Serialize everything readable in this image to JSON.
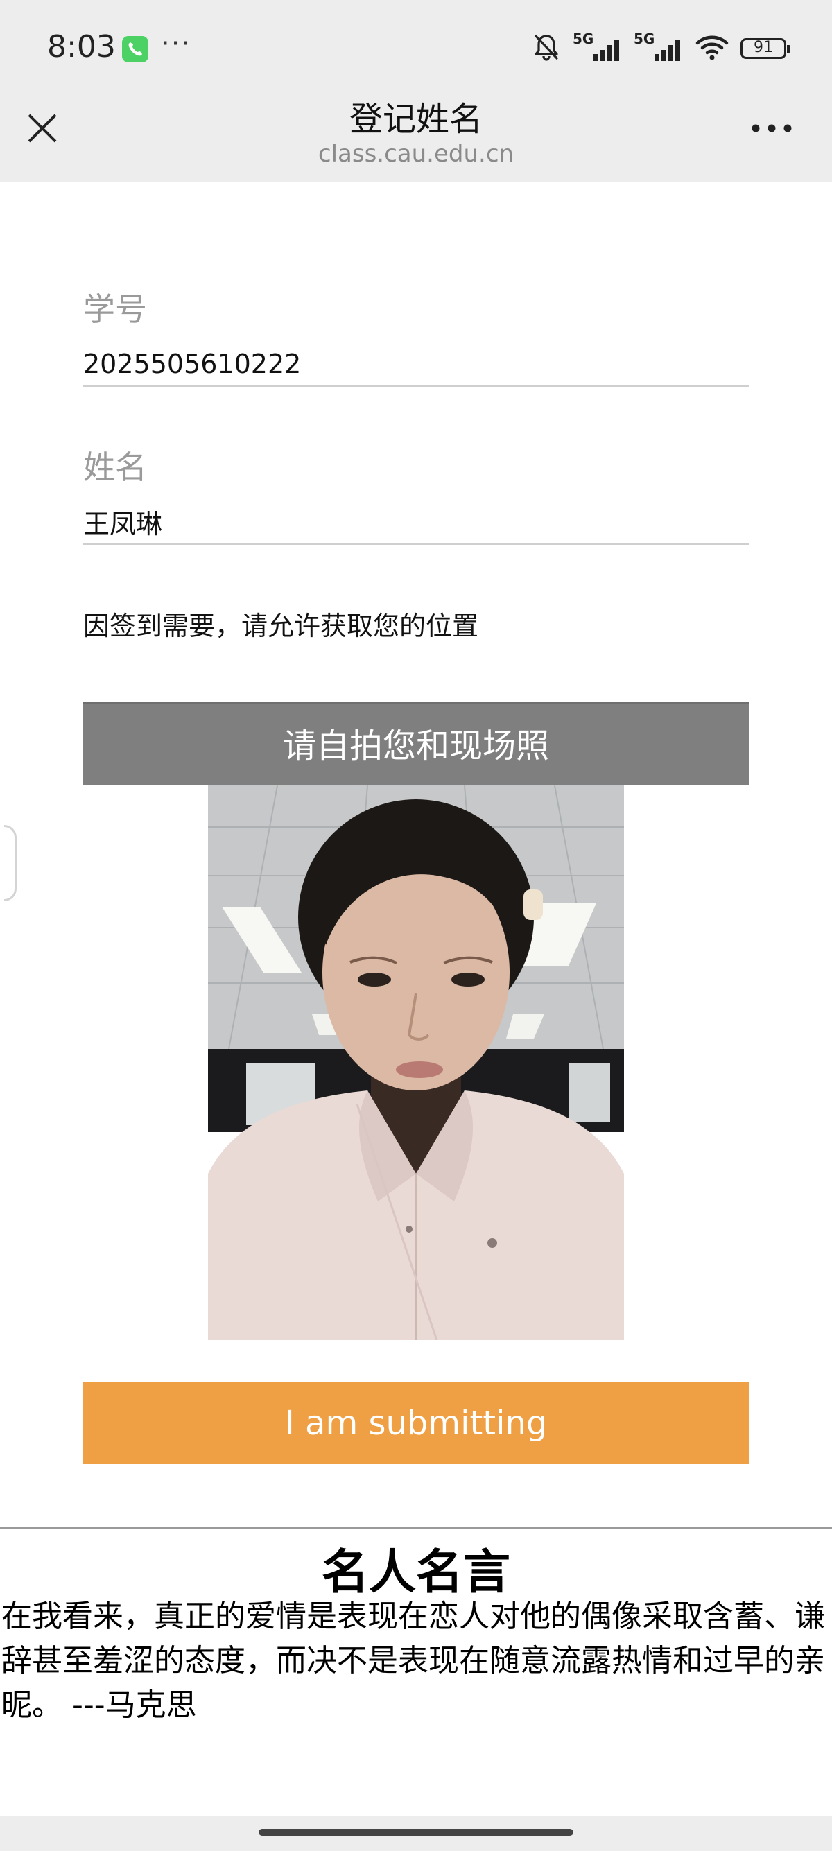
{
  "status_bar": {
    "time": "8:03",
    "call_icon": "phone-icon",
    "more": "···",
    "network_1": "5G",
    "network_2": "5G",
    "battery": "91",
    "icons": [
      "bell-muted-icon",
      "signal-icon",
      "signal-icon",
      "wifi-icon",
      "battery-icon"
    ]
  },
  "nav": {
    "title": "登记姓名",
    "subtitle": "class.cau.edu.cn",
    "close_icon": "close-icon",
    "more_icon": "more-icon"
  },
  "form": {
    "student_id_label": "学号",
    "student_id_value": "2025505610222",
    "name_label": "姓名",
    "name_value": "王凤琳",
    "location_note": "因签到需要，请允许获取您的位置",
    "selfie_button": "请自拍您和现场照",
    "submit_button": "I am submitting"
  },
  "quote": {
    "title": "名人名言",
    "text": " 在我看来，真正的爱情是表现在恋人对他的偶像采取含蓄、谦辞甚至羞涩的态度，而决不是表现在随意流露热情和过早的亲昵。 ---马克思"
  },
  "colors": {
    "header_bg": "#ededed",
    "selfie_button_bg": "#7f7f7f",
    "submit_button_bg": "#f0a044"
  }
}
